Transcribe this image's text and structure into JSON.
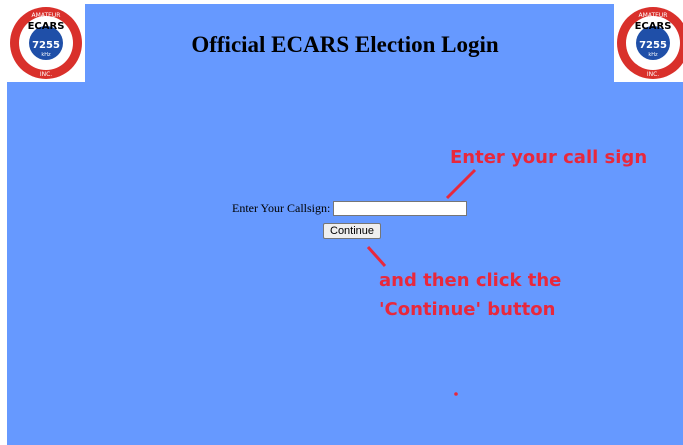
{
  "header": {
    "title": "Official ECARS Election Login",
    "logo": {
      "top_text": "AMATEUR",
      "letters": "ECARS",
      "number": "7255",
      "unit": "kHz",
      "bottom_text": "INC."
    }
  },
  "form": {
    "callsign_label": "Enter Your Callsign:",
    "callsign_value": "",
    "continue_label": "Continue"
  },
  "annotations": {
    "call_sign_hint": "Enter your call sign",
    "continue_hint_line1": "and then click the",
    "continue_hint_line2": "'Continue' button"
  },
  "colors": {
    "page_background": "#6699ff",
    "annotation": "#e8283c",
    "logo_ring": "#d9302b",
    "logo_center": "#1f4fa8"
  }
}
